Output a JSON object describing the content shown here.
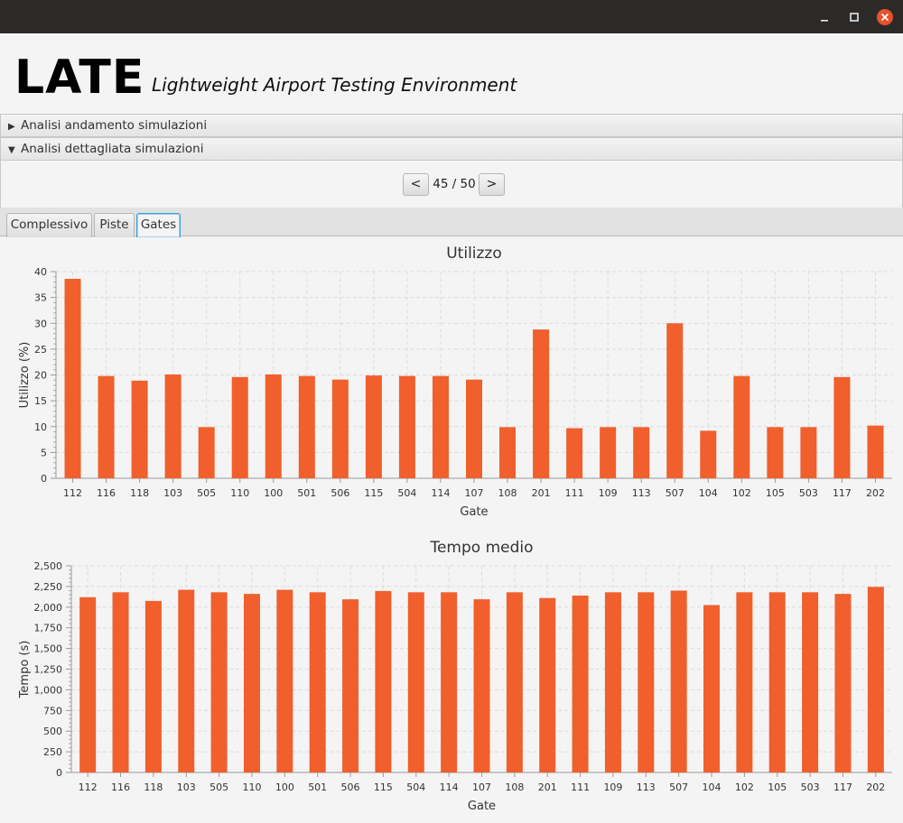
{
  "window": {
    "controls": [
      "minimize-icon",
      "maximize-icon",
      "close-icon"
    ],
    "close_color": "#e5522b"
  },
  "header": {
    "logo": "LATE",
    "subtitle": "Lightweight Airport Testing Environment"
  },
  "panes": [
    {
      "label": "Analisi andamento simulazioni",
      "expanded": false
    },
    {
      "label": "Analisi dettagliata simulazioni",
      "expanded": true
    }
  ],
  "pager": {
    "prev_label": "<",
    "next_label": ">",
    "indicator": "45 / 50"
  },
  "tabs": [
    {
      "label": "Complessivo",
      "selected": false
    },
    {
      "label": "Piste",
      "selected": false
    },
    {
      "label": "Gates",
      "selected": true
    }
  ],
  "colors": {
    "bar": "#f05f2c",
    "accent": "#3c9ed8"
  },
  "chart_data": [
    {
      "type": "bar",
      "title": "Utilizzo",
      "xlabel": "Gate",
      "ylabel": "Utilizzo (%)",
      "ylim": [
        0,
        40
      ],
      "yticks": [
        "0",
        "5",
        "10",
        "15",
        "20",
        "25",
        "30",
        "35",
        "40"
      ],
      "grid": true,
      "categories": [
        "112",
        "116",
        "118",
        "103",
        "505",
        "110",
        "100",
        "501",
        "506",
        "115",
        "504",
        "114",
        "107",
        "108",
        "201",
        "111",
        "109",
        "113",
        "507",
        "104",
        "102",
        "105",
        "503",
        "117",
        "202"
      ],
      "values": [
        38.6,
        19.8,
        18.9,
        20.1,
        9.9,
        19.6,
        20.1,
        19.8,
        19.1,
        19.9,
        19.8,
        19.8,
        19.1,
        9.9,
        28.8,
        9.7,
        9.9,
        9.9,
        30.0,
        9.2,
        19.8,
        9.9,
        9.9,
        19.6,
        10.2
      ]
    },
    {
      "type": "bar",
      "title": "Tempo medio",
      "xlabel": "Gate",
      "ylabel": "Tempo (s)",
      "ylim": [
        0,
        2500
      ],
      "yticks": [
        "0",
        "250",
        "500",
        "750",
        "1,000",
        "1,250",
        "1,500",
        "1,750",
        "2,000",
        "2,250",
        "2,500"
      ],
      "grid": true,
      "categories": [
        "112",
        "116",
        "118",
        "103",
        "505",
        "110",
        "100",
        "501",
        "506",
        "115",
        "504",
        "114",
        "107",
        "108",
        "201",
        "111",
        "109",
        "113",
        "507",
        "104",
        "102",
        "105",
        "503",
        "117",
        "202"
      ],
      "values": [
        2120,
        2180,
        2075,
        2210,
        2180,
        2160,
        2210,
        2180,
        2095,
        2195,
        2180,
        2180,
        2095,
        2180,
        2110,
        2140,
        2180,
        2180,
        2200,
        2025,
        2180,
        2180,
        2180,
        2160,
        2245
      ]
    }
  ]
}
